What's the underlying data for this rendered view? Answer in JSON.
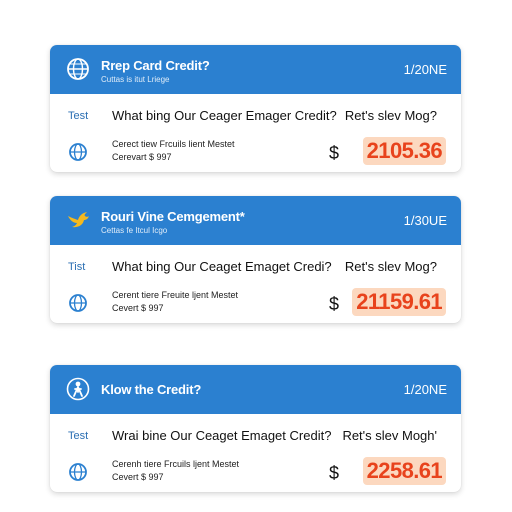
{
  "cards": [
    {
      "title": "Rrep Card Credit?",
      "subtitle": "Cuttas is itut Lriege",
      "count": "1/20NE",
      "tag": "Test",
      "question": "What bing Our Ceager Emager Credit?",
      "answer": "Ret's slev Mog?",
      "detail_line1": "Cerect tiew Frcuils lient Mestet",
      "detail_line2": "Cerevart $ 997",
      "currency": "$",
      "amount": "2105.36",
      "header_icon": "globe-icon",
      "body_icon": "globe-icon"
    },
    {
      "title": "Rouri Vine Cemgement*",
      "subtitle": "Cettas fe Itcul Icgo",
      "count": "1/30UE",
      "tag": "Tist",
      "question": "What bing Our Ceaget Emaget Credi?",
      "answer": "Ret's slev Mog?",
      "detail_line1": "Cerent tiere Freuite ljent Mestet",
      "detail_line2": "Cevert $ 997",
      "currency": "$",
      "amount": "21159.61",
      "header_icon": "bird-icon",
      "body_icon": "globe-icon"
    },
    {
      "title": "Klow the Credit?",
      "subtitle": "",
      "count": "1/20NE",
      "tag": "Test",
      "question": "Wrai bine Our Ceaget Emaget Credit?",
      "answer": "Ret's slev Mogh'",
      "detail_line1": "Cerenh tiere Frcuils ljent Mestet",
      "detail_line2": "Cevert $ 997",
      "currency": "$",
      "amount": "2258.61",
      "header_icon": "person-icon",
      "body_icon": "globe-icon"
    }
  ],
  "colors": {
    "header": "#2b80d0",
    "amount_text": "#e8431c",
    "amount_bg": "#fcd8bf",
    "bird": "#f5b91e"
  }
}
